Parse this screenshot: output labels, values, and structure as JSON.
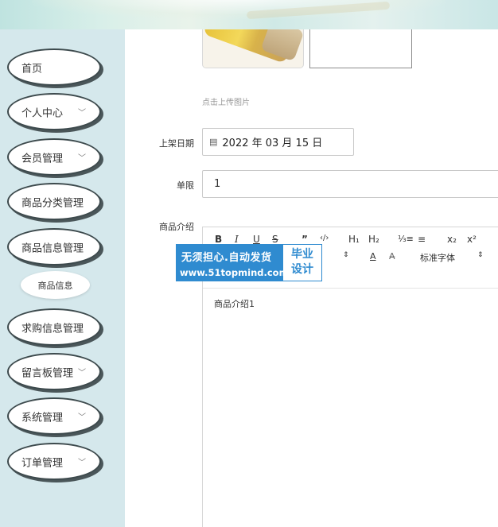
{
  "sidebar": {
    "items": [
      {
        "label": "首页",
        "chevron": ""
      },
      {
        "label": "个人中心",
        "chevron": "﹀"
      },
      {
        "label": "会员管理",
        "chevron": "﹀"
      },
      {
        "label": "商品分类管理",
        "chevron": ""
      },
      {
        "label": "商品信息管理",
        "chevron": ""
      },
      {
        "label": "求购信息管理",
        "chevron": ""
      },
      {
        "label": "留言板管理",
        "chevron": "﹀"
      },
      {
        "label": "系统管理",
        "chevron": "﹀"
      },
      {
        "label": "订单管理",
        "chevron": "﹀"
      }
    ],
    "submenu": {
      "label": "商品信息"
    }
  },
  "form": {
    "upload_hint": "点击上传图片",
    "date_label": "上架日期",
    "date_icon": "calendar-icon",
    "date_value": "2022 年 03 月 15 日",
    "limit_label": "单限",
    "limit_value": "1",
    "intro_label": "商品介绍"
  },
  "editor": {
    "toolbar_row1": [
      "B",
      "I",
      "U",
      "S",
      "”",
      "‹/›",
      "H₁",
      "H₂",
      "⅓≡",
      "≡",
      "x₂",
      "x²"
    ],
    "toolbar_row2": [
      "⇕",
      "A",
      "A̶",
      "标准字体",
      "⇕"
    ],
    "content": "商品介绍1"
  },
  "watermark": {
    "line1": "无须担心.自动发货",
    "line2": "www.51topmind.com",
    "right_top": "毕业",
    "right_bottom": "设计"
  }
}
